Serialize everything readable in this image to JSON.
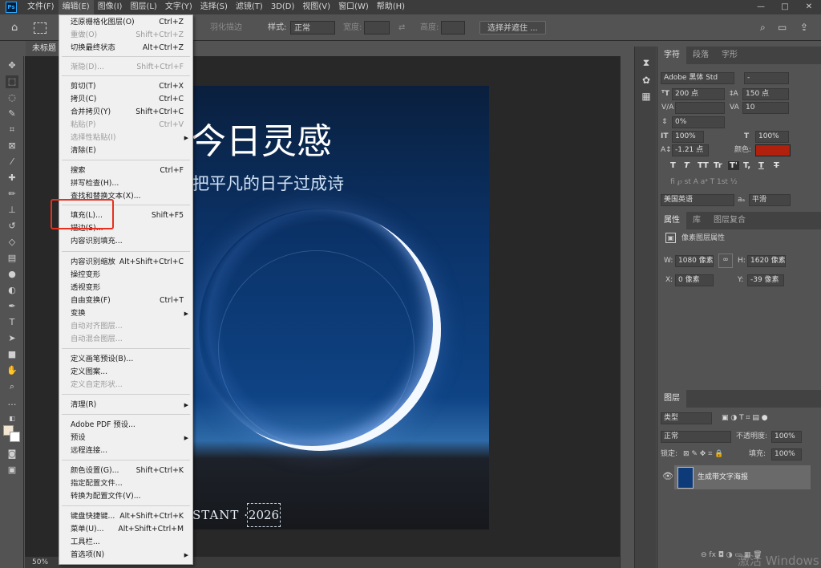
{
  "app": {
    "logo": "Ps"
  },
  "menubar": [
    "文件(F)",
    "编辑(E)",
    "图像(I)",
    "图层(L)",
    "文字(Y)",
    "选择(S)",
    "滤镜(T)",
    "3D(D)",
    "视图(V)",
    "窗口(W)",
    "帮助(H)"
  ],
  "window_controls": [
    "—",
    "□",
    "✕"
  ],
  "options_bar": {
    "feather": "羽化描边",
    "style_label": "样式:",
    "style_value": "正常",
    "width_label": "宽度:",
    "height_label": "高度:",
    "select_mask": "选择并遮住 ..."
  },
  "document_tab": "未标题",
  "zoom": "50%",
  "edit_menu": [
    {
      "label": "还原栅格化图层(O)",
      "shortcut": "Ctrl+Z",
      "disabled": false
    },
    {
      "label": "重做(O)",
      "shortcut": "Shift+Ctrl+Z",
      "disabled": true
    },
    {
      "label": "切换最终状态",
      "shortcut": "Alt+Ctrl+Z",
      "disabled": false
    },
    {
      "label": "渐隐(D)...",
      "shortcut": "Shift+Ctrl+F",
      "disabled": true
    },
    {
      "label": "剪切(T)",
      "shortcut": "Ctrl+X",
      "disabled": false
    },
    {
      "label": "拷贝(C)",
      "shortcut": "Ctrl+C",
      "disabled": false
    },
    {
      "label": "合并拷贝(Y)",
      "shortcut": "Shift+Ctrl+C",
      "disabled": false
    },
    {
      "label": "粘贴(P)",
      "shortcut": "Ctrl+V",
      "disabled": true
    },
    {
      "label": "选择性粘贴(I)",
      "shortcut": "",
      "disabled": true
    },
    {
      "label": "清除(E)",
      "shortcut": "",
      "disabled": false
    },
    {
      "label": "搜索",
      "shortcut": "Ctrl+F",
      "disabled": false
    },
    {
      "label": "拼写检查(H)...",
      "shortcut": "",
      "disabled": false
    },
    {
      "label": "查找和替换文本(X)...",
      "shortcut": "",
      "disabled": false
    },
    {
      "label": "填充(L)...",
      "shortcut": "Shift+F5",
      "disabled": false
    },
    {
      "label": "描边(S)...",
      "shortcut": "",
      "disabled": false
    },
    {
      "label": "内容识别填充...",
      "shortcut": "",
      "disabled": false
    },
    {
      "label": "内容识别缩放",
      "shortcut": "Alt+Shift+Ctrl+C",
      "disabled": false
    },
    {
      "label": "操控变形",
      "shortcut": "",
      "disabled": false
    },
    {
      "label": "透视变形",
      "shortcut": "",
      "disabled": false
    },
    {
      "label": "自由变换(F)",
      "shortcut": "Ctrl+T",
      "disabled": false
    },
    {
      "label": "变换",
      "shortcut": "",
      "disabled": false
    },
    {
      "label": "自动对齐图层...",
      "shortcut": "",
      "disabled": true
    },
    {
      "label": "自动混合图层...",
      "shortcut": "",
      "disabled": true
    },
    {
      "label": "定义画笔预设(B)...",
      "shortcut": "",
      "disabled": false
    },
    {
      "label": "定义图案...",
      "shortcut": "",
      "disabled": false
    },
    {
      "label": "定义自定形状...",
      "shortcut": "",
      "disabled": true
    },
    {
      "label": "清理(R)",
      "shortcut": "",
      "disabled": false
    },
    {
      "label": "Adobe PDF 预设...",
      "shortcut": "",
      "disabled": false
    },
    {
      "label": "预设",
      "shortcut": "",
      "disabled": false
    },
    {
      "label": "远程连接...",
      "shortcut": "",
      "disabled": false
    },
    {
      "label": "颜色设置(G)...",
      "shortcut": "Shift+Ctrl+K",
      "disabled": false
    },
    {
      "label": "指定配置文件...",
      "shortcut": "",
      "disabled": false
    },
    {
      "label": "转换为配置文件(V)...",
      "shortcut": "",
      "disabled": false
    },
    {
      "label": "键盘快捷键...",
      "shortcut": "Alt+Shift+Ctrl+K",
      "disabled": false
    },
    {
      "label": "菜单(U)...",
      "shortcut": "Alt+Shift+Ctrl+M",
      "disabled": false
    },
    {
      "label": "工具栏...",
      "shortcut": "",
      "disabled": false
    },
    {
      "label": "首选项(N)",
      "shortcut": "",
      "disabled": false
    }
  ],
  "poster": {
    "title": "今日灵感",
    "subtitle": "把平凡的日子过成诗",
    "footer": "STANT ·",
    "year": "2026"
  },
  "character_panel": {
    "tabs": [
      "字符",
      "段落",
      "字形"
    ],
    "font": "Adobe 黑体 Std",
    "font_style": "-",
    "size": "200 点",
    "leading": "150 点",
    "kerning": "",
    "tracking": "10",
    "vscale_pct": "0%",
    "hscale": "100%",
    "vscale": "100%",
    "baseline": "-1.21 点",
    "color_label": "颜色:",
    "color": "#b0200c",
    "type_buttons": [
      "T",
      "T",
      "TT",
      "Tr",
      "T'",
      "T,",
      "T",
      "T"
    ],
    "language": "美国英语",
    "aa_label": "aₐ",
    "aa": "平滑"
  },
  "properties_panel": {
    "tabs": [
      "属性",
      "库",
      "图层复合"
    ],
    "title": "像素图层属性",
    "w_label": "W:",
    "w": "1080 像素",
    "h_label": "H:",
    "h": "1620 像素",
    "x_label": "X:",
    "x": "0 像素",
    "y_label": "Y:",
    "y": "-39 像素"
  },
  "layers_panel": {
    "tab": "图层",
    "filter": "类型",
    "blend": "正常",
    "opacity_label": "不透明度:",
    "opacity": "100%",
    "lock_label": "锁定:",
    "fill_label": "填充:",
    "fill": "100%",
    "layer_name": "生成带文字海报"
  },
  "watermark": "激活 Windows"
}
